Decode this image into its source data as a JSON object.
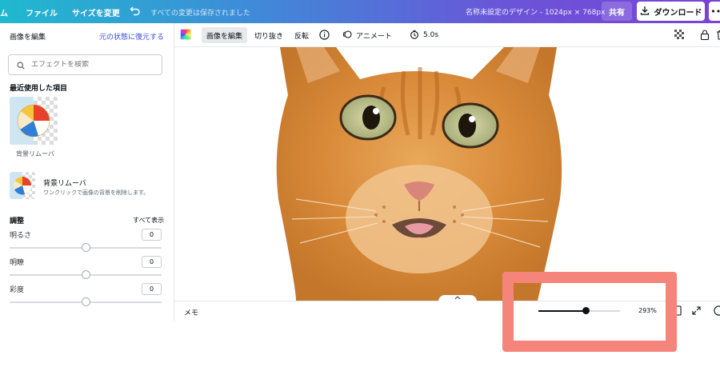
{
  "topbar": {
    "home_partial": "ム",
    "file": "ファイル",
    "resize": "サイズを変更",
    "saved_status": "すべての変更は保存されました",
    "doc_title": "名称未設定のデザイン - 1024px × 768px",
    "share": "共有",
    "download": "ダウンロード",
    "more": "•••"
  },
  "left_panel": {
    "title": "画像を編集",
    "restore": "元の状態に復元する",
    "search_placeholder": "エフェクトを検索",
    "recent_title": "最近使用した項目",
    "recent_item_label": "背景リムーバ",
    "effect_name": "背景リムーバ",
    "effect_desc": "ワンクリックで画像の背景を削除します。",
    "adjust_title": "調整",
    "show_all": "すべて表示",
    "sliders": [
      {
        "label": "明るさ",
        "value": "0"
      },
      {
        "label": "明瞭",
        "value": "0"
      },
      {
        "label": "彩度",
        "value": "0"
      }
    ]
  },
  "toolbar": {
    "edit_image": "画像を編集",
    "crop": "切り抜き",
    "flip": "反転",
    "animate": "アニメート",
    "duration": "5.0s"
  },
  "bottombar": {
    "notes": "メモ",
    "zoom_value": "293%",
    "zoom_fraction": 0.58
  },
  "colors": {
    "highlight": "#f5847a",
    "restore_link": "#3b4bd8"
  }
}
